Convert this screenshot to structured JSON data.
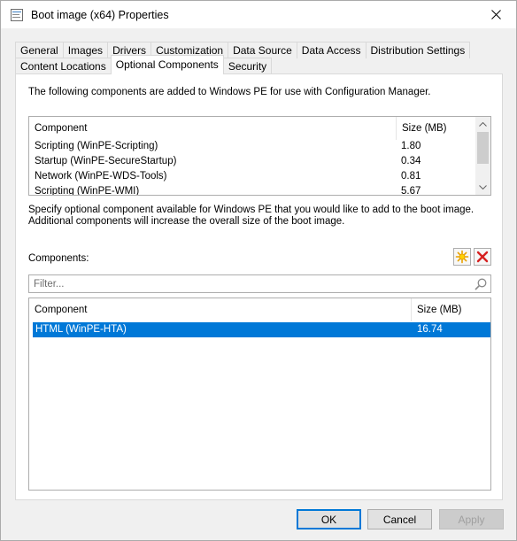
{
  "window": {
    "title": "Boot image (x64) Properties",
    "close_icon": "close-icon",
    "title_icon": "properties-icon"
  },
  "tabs": {
    "row1": [
      "General",
      "Images",
      "Drivers",
      "Customization",
      "Data Source",
      "Data Access",
      "Distribution Settings"
    ],
    "row2": [
      "Content Locations",
      "Optional Components",
      "Security"
    ],
    "active": "Optional Components"
  },
  "installed": {
    "description": "The following components are added to Windows PE for use with Configuration Manager.",
    "columns": [
      "Component",
      "Size (MB)"
    ],
    "rows": [
      {
        "component": "Scripting (WinPE-Scripting)",
        "size": "1.80"
      },
      {
        "component": "Startup (WinPE-SecureStartup)",
        "size": "0.34"
      },
      {
        "component": "Network (WinPE-WDS-Tools)",
        "size": "0.81"
      },
      {
        "component": "Scripting (WinPE-WMI)",
        "size": "5.67"
      }
    ]
  },
  "optional": {
    "description": "Specify optional component available for Windows PE that you would like to add to the boot image. Additional components will increase the overall size of the boot image.",
    "label": "Components:",
    "filter_placeholder": "Filter...",
    "filter_value": "",
    "columns": [
      "Component",
      "Size (MB)"
    ],
    "rows": [
      {
        "component": "HTML (WinPE-HTA)",
        "size": "16.74",
        "selected": true
      }
    ]
  },
  "buttons": {
    "ok": "OK",
    "cancel": "Cancel",
    "apply": "Apply"
  },
  "colors": {
    "selection": "#0078d7",
    "default_button_border": "#0078d7"
  }
}
